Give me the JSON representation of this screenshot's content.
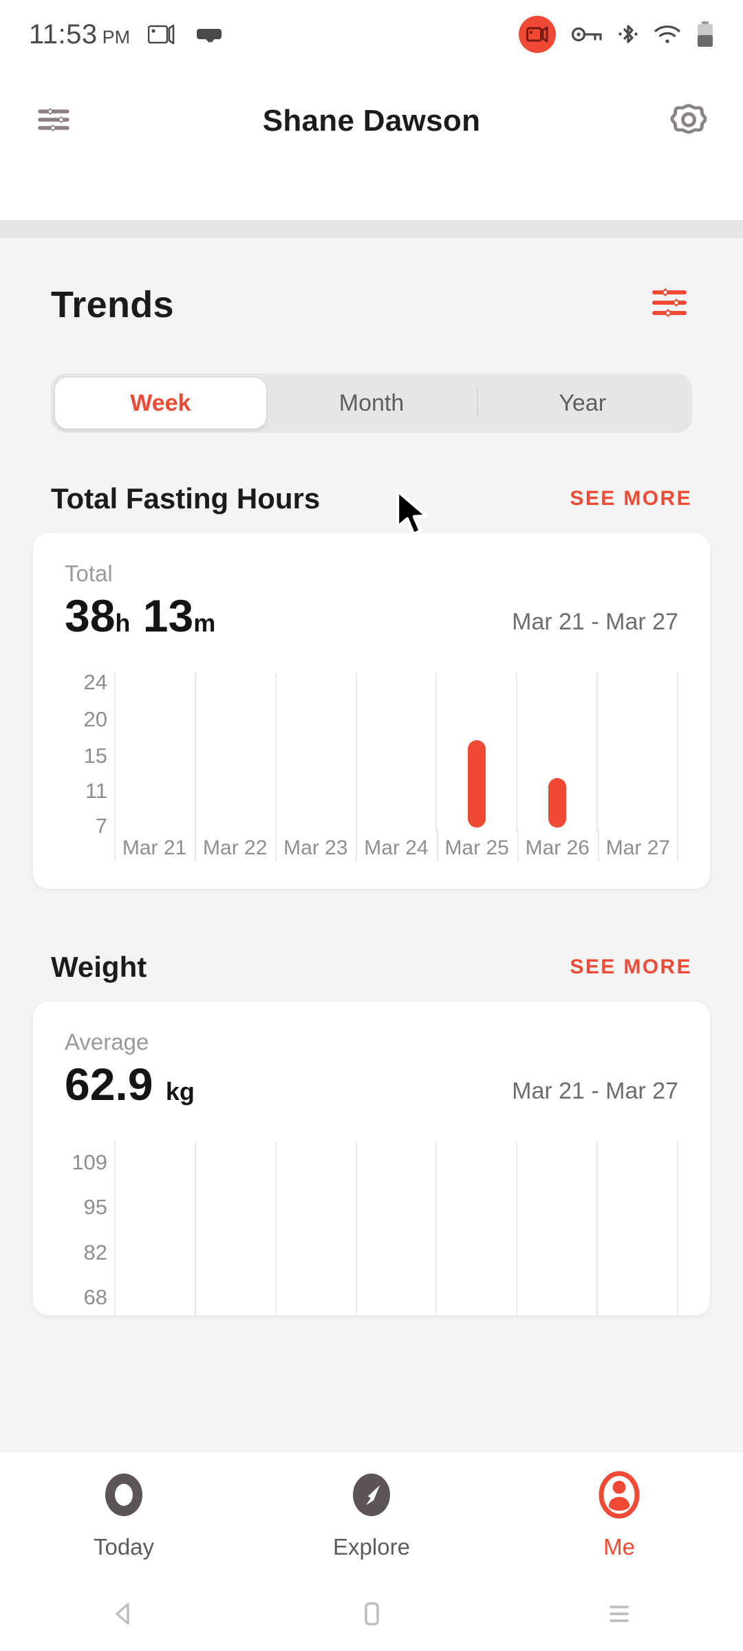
{
  "status_bar": {
    "time": "11:53",
    "ampm": "PM",
    "icons": [
      "screen-cast-icon",
      "vr-check-icon",
      "screen-record-icon",
      "vpn-key-icon",
      "bluetooth-icon",
      "wifi-icon",
      "battery-icon"
    ]
  },
  "app_header": {
    "title": "Shane Dawson",
    "left_icon": "sliders-icon",
    "right_icon": "settings-gear-icon"
  },
  "trends": {
    "title": "Trends",
    "filter_icon": "sliders-icon",
    "tabs": [
      {
        "label": "Week",
        "active": true
      },
      {
        "label": "Month",
        "active": false
      },
      {
        "label": "Year",
        "active": false
      }
    ]
  },
  "fasting_section": {
    "title": "Total Fasting Hours",
    "see_more": "SEE MORE",
    "stat_label": "Total",
    "stat_hours": "38",
    "stat_hours_unit": "h",
    "stat_minutes": "13",
    "stat_minutes_unit": "m",
    "range": "Mar 21 - Mar 27"
  },
  "weight_section": {
    "title": "Weight",
    "see_more": "SEE MORE",
    "stat_label": "Average",
    "stat_value": "62.9",
    "stat_unit": "kg",
    "range": "Mar 21 - Mar 27"
  },
  "bottom_nav": [
    {
      "label": "Today",
      "icon": "ring-icon",
      "active": false
    },
    {
      "label": "Explore",
      "icon": "compass-icon",
      "active": false
    },
    {
      "label": "Me",
      "icon": "person-icon",
      "active": true
    }
  ],
  "android_nav": [
    {
      "icon": "back-triangle-icon"
    },
    {
      "icon": "home-square-icon"
    },
    {
      "icon": "recents-lines-icon"
    }
  ],
  "colors": {
    "accent": "#ef4a35",
    "background": "#f5f4f4",
    "card": "#ffffff",
    "text_primary": "#1b1b1b",
    "text_muted": "#8e8e8e"
  },
  "chart_data": [
    {
      "type": "bar",
      "title": "Total Fasting Hours",
      "categories": [
        "Mar 21",
        "Mar 22",
        "Mar 23",
        "Mar 24",
        "Mar 25",
        "Mar 26",
        "Mar 27"
      ],
      "yticks": [
        24,
        20,
        15,
        11,
        7
      ],
      "ylim": [
        7,
        26
      ],
      "ylabel": "",
      "xlabel": "",
      "grid": "vertical",
      "legend": "none",
      "bar_color": "#ef4a35",
      "series": [
        {
          "name": "Fasting hours",
          "bars": [
            {
              "category": "Mar 21",
              "start": null,
              "end": null
            },
            {
              "category": "Mar 22",
              "start": null,
              "end": null
            },
            {
              "category": "Mar 23",
              "start": null,
              "end": null
            },
            {
              "category": "Mar 24",
              "start": null,
              "end": null
            },
            {
              "category": "Mar 25",
              "start": 7,
              "end": 18
            },
            {
              "category": "Mar 26",
              "start": 7,
              "end": 13
            },
            {
              "category": "Mar 27",
              "start": null,
              "end": null
            }
          ]
        }
      ]
    },
    {
      "type": "line",
      "title": "Weight",
      "categories": [
        "Mar 21",
        "Mar 22",
        "Mar 23",
        "Mar 24",
        "Mar 25",
        "Mar 26",
        "Mar 27"
      ],
      "yticks": [
        109,
        95,
        82,
        68
      ],
      "ylim": [
        68,
        116
      ],
      "ylabel": "kg",
      "xlabel": "",
      "grid": "vertical",
      "legend": "none",
      "values": [],
      "note": "chart area clipped by bottom navigation; no data points visible"
    }
  ]
}
